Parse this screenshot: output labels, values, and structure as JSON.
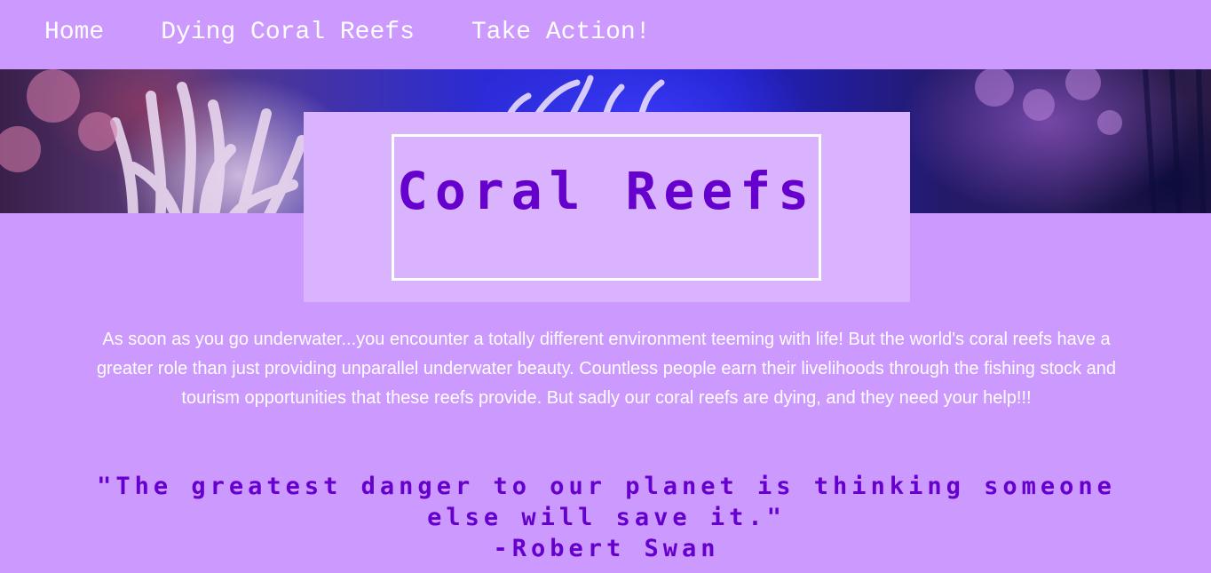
{
  "nav": {
    "items": [
      {
        "label": "Home"
      },
      {
        "label": "Dying Coral Reefs"
      },
      {
        "label": "Take Action!"
      }
    ]
  },
  "hero": {
    "title": "Coral Reefs"
  },
  "intro": {
    "text": "As soon as you go underwater...you encounter a totally different environment teeming with life! But the world's coral reefs have a greater role than just providing unparallel underwater beauty. Countless people earn their livelihoods through the fishing stock and tourism opportunities that these reefs provide. But sadly our coral reefs are dying, and they need your help!!!"
  },
  "quote": {
    "text": "\"The greatest danger to our planet is thinking someone else will save it.\"",
    "author": "-Robert Swan"
  },
  "colors": {
    "background": "#cc99ff",
    "card": "#dab3ff",
    "accent": "#6600cc",
    "text": "#ffffff"
  }
}
